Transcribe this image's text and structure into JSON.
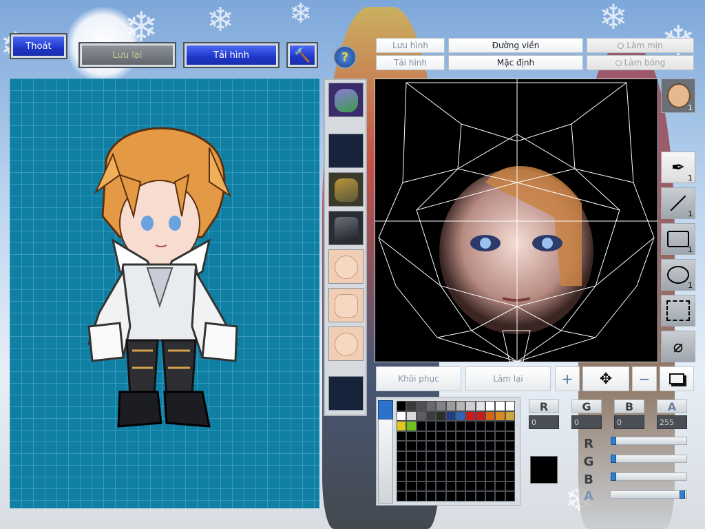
{
  "top_buttons": {
    "exit_label": "Thoát",
    "save_label": "Lưu lại",
    "reload_label": "Tải hình"
  },
  "tabs": {
    "save_image": "Lưu hình",
    "outline": "Đường viền",
    "smooth": "Làm mịn",
    "load_image": "Tải hình",
    "default": "Mặc định",
    "shadow": "Làm bóng"
  },
  "tool_counts": {
    "pen": "1",
    "line": "1",
    "rect": "1",
    "ellipse": "1",
    "face": "1"
  },
  "bottom_controls": {
    "restore": "Khôi phục",
    "redo": "Làm lại"
  },
  "channels": {
    "r_label": "R",
    "g_label": "G",
    "b_label": "B",
    "a_label": "A",
    "r_value": "0",
    "g_value": "0",
    "b_value": "0",
    "a_value": "255"
  },
  "sliders": {
    "r": 0,
    "g": 0,
    "b": 0,
    "a": 255
  },
  "current_color": "#000000",
  "palette_row1": [
    "#000000",
    "#3a3a3a",
    "#505050",
    "#6a6a6a",
    "#838383",
    "#9c9c9c",
    "#b5b5b5",
    "#cecece",
    "#e5e5e5",
    "#ffffff",
    "#ffffff",
    "#ffffff"
  ],
  "palette_row2": [
    "#ffffff",
    "#d9d9d9",
    "#5e5e5e",
    "#3b3b3b",
    "#2c2c2c",
    "#1c3e86",
    "#3264b4",
    "#c81c1c",
    "#c81c1c",
    "#d8641a",
    "#d88a1a",
    "#cfa63c"
  ],
  "palette_row3": [
    "#e2c81c",
    "#6fc21d",
    "#000000",
    "#000000",
    "#000000",
    "#000000",
    "#000000",
    "#000000",
    "#000000",
    "#000000",
    "#000000",
    "#000000"
  ]
}
